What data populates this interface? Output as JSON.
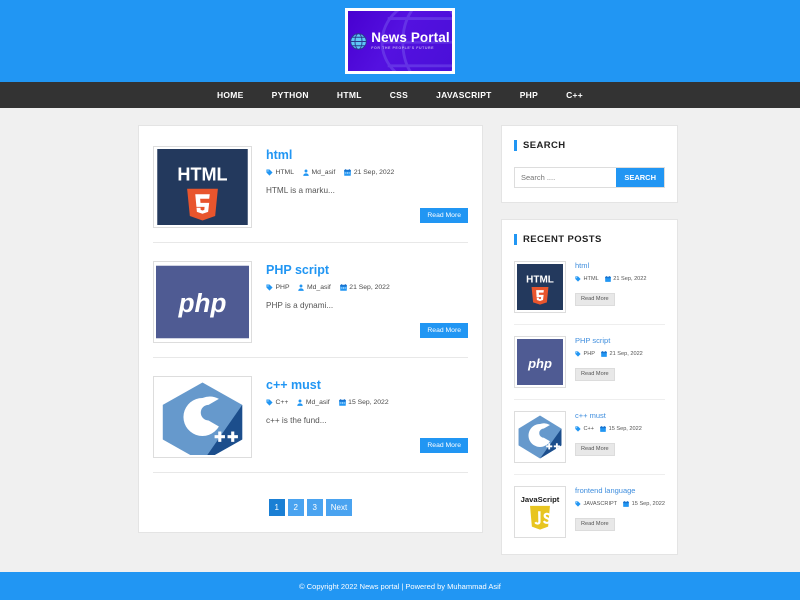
{
  "header": {
    "logo": {
      "title": "News Portal",
      "tagline": "FOR THE PEOPLE'S FUTURE",
      "background": "#4a0fd8",
      "border": "#ffffff"
    },
    "background": "#2196f3"
  },
  "nav": {
    "background": "#333333",
    "items": [
      {
        "label": "HOME"
      },
      {
        "label": "PYTHON"
      },
      {
        "label": "HTML"
      },
      {
        "label": "CSS"
      },
      {
        "label": "JAVASCRIPT"
      },
      {
        "label": "PHP"
      },
      {
        "label": "C++"
      }
    ]
  },
  "posts": [
    {
      "title": "html",
      "category": "HTML",
      "author": "Md_asif",
      "date": "21 Sep, 2022",
      "excerpt": "HTML is a marku...",
      "read_more": "Read More",
      "thumb": "html5-logo"
    },
    {
      "title": "PHP script",
      "category": "PHP",
      "author": "Md_asif",
      "date": "21 Sep, 2022",
      "excerpt": "PHP is a dynami...",
      "read_more": "Read More",
      "thumb": "php-logo"
    },
    {
      "title": "c++ must",
      "category": "C++",
      "author": "Md_asif",
      "date": "15 Sep, 2022",
      "excerpt": "c++ is the fund...",
      "read_more": "Read More",
      "thumb": "cpp-logo"
    }
  ],
  "pagination": {
    "pages": [
      {
        "label": "1",
        "active": true
      },
      {
        "label": "2",
        "active": false
      },
      {
        "label": "3",
        "active": false
      },
      {
        "label": "Next",
        "active": false
      }
    ]
  },
  "sidebar": {
    "search": {
      "title": "SEARCH",
      "placeholder": "Search ....",
      "value": "",
      "button_label": "SEARCH",
      "button_color": "#2196f3"
    },
    "recent": {
      "title": "RECENT POSTS",
      "items": [
        {
          "title": "html",
          "category": "HTML",
          "date": "21 Sep, 2022",
          "read_more": "Read More",
          "thumb": "html5-logo"
        },
        {
          "title": "PHP script",
          "category": "PHP",
          "date": "21 Sep, 2022",
          "read_more": "Read More",
          "thumb": "php-logo"
        },
        {
          "title": "c++ must",
          "category": "C++",
          "date": "15 Sep, 2022",
          "read_more": "Read More",
          "thumb": "cpp-logo"
        },
        {
          "title": "frontend language",
          "category": "JAVASCRIPT",
          "date": "15 Sep, 2022",
          "read_more": "Read More",
          "thumb": "javascript-logo"
        }
      ]
    }
  },
  "footer": {
    "text": "© Copyright 2022 News portal | Powered by Muhammad Asif",
    "background": "#2196f3"
  },
  "icons": {
    "tag": "tag-icon",
    "user": "user-icon",
    "calendar": "calendar-icon",
    "globe": "globe-icon"
  }
}
